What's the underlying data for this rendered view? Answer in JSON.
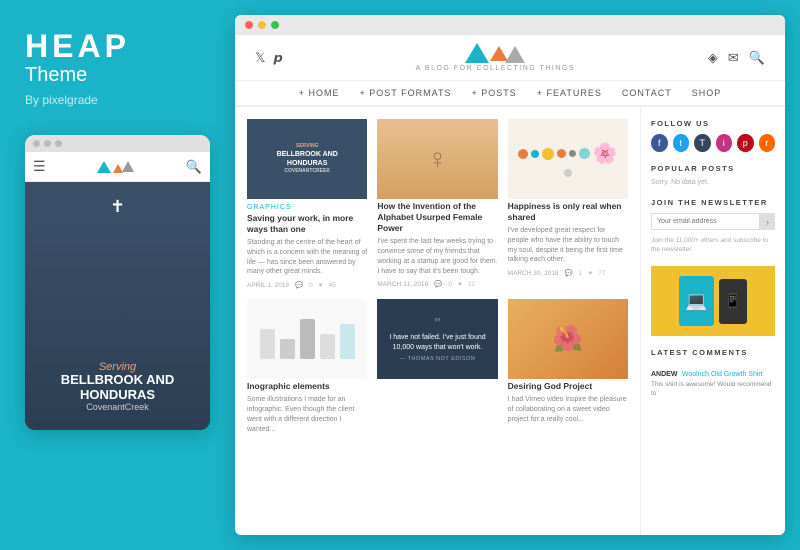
{
  "brand": {
    "name": "HEAP",
    "subtitle": "Theme",
    "by": "By pixelgrade"
  },
  "mobile_preview": {
    "dots": [
      "dot1",
      "dot2",
      "dot3"
    ],
    "post": {
      "italic_line": "Serving",
      "line1": "BELLBROOK AND",
      "line2": "HONDURAS",
      "line3": "CovenantCreek"
    }
  },
  "browser": {
    "dots": [
      "red",
      "yellow",
      "green"
    ]
  },
  "site": {
    "tagline": "A BLOG FOR COLLECTING THINGS",
    "nav_items": [
      "+ HOME",
      "+ POST FORMATS",
      "+ POSTS",
      "+ FEATURES",
      "CONTACT",
      "SHOP"
    ]
  },
  "posts": [
    {
      "category": "GRAPHICS",
      "title": "Saving your work, in more ways than one",
      "excerpt": "Standing at the centre of the heart of which is a concern with the meaning of life — has since been answered by many other great minds.",
      "date": "APRIL 1, 2018",
      "comments": "0",
      "likes": "45"
    },
    {
      "category": "",
      "title": "How the Invention of the Alphabet Usurped Female Power",
      "excerpt": "I've spent the last few weeks trying to convince some of my friends that working at a startup are good for them. I have to say that it's been tough.",
      "date": "MARCH 31, 2018",
      "comments": "0",
      "likes": "22"
    },
    {
      "category": "",
      "title": "Happiness is only real when shared",
      "excerpt": "I've developed great respect for people who have the ability to touch my soul, despite it being the first time talking each other.",
      "date": "MARCH 30, 2018",
      "comments": "1",
      "likes": "77"
    },
    {
      "category": "",
      "title": "Inographic elements",
      "excerpt": "Some illustrations I made for an infographic. Even though the client went with a different direction I wanted...",
      "date": "",
      "comments": "",
      "likes": ""
    },
    {
      "category": "",
      "title": "",
      "excerpt": "",
      "quote": "I have not failed. I've just found 10,000 ways that won't work.",
      "attribution": "— THOMAS NOT EDISON",
      "date": "",
      "comments": "",
      "likes": ""
    },
    {
      "category": "",
      "title": "Desiring God Project",
      "excerpt": "I had Vimeo video inspire the pleasure of collaborating on a sweet video project for a really cool...",
      "date": "",
      "comments": "",
      "likes": ""
    }
  ],
  "sidebar": {
    "follow_us_label": "FOLLOW US",
    "follow_icons": [
      {
        "name": "facebook",
        "char": "f"
      },
      {
        "name": "twitter",
        "char": "t"
      },
      {
        "name": "tumblr",
        "char": "T"
      },
      {
        "name": "instagram",
        "char": "i"
      },
      {
        "name": "pinterest",
        "char": "p"
      },
      {
        "name": "rss",
        "char": "r"
      }
    ],
    "popular_posts_label": "POPULAR POSTS",
    "popular_posts_empty": "Sorry. No data yet.",
    "newsletter_label": "JOIN THE NEWSLETTER",
    "newsletter_placeholder": "Your email address",
    "newsletter_desc": "Join the 11,000+ others and subscribe to the newsletter.",
    "newsletter_btn": "›",
    "latest_comments_label": "LATEST COMMENTS",
    "comments": [
      {
        "author": "ANDEW",
        "product": "Woolrich Old Growth Shirt",
        "text": "This shirt is awesome! Would recommend to"
      }
    ]
  }
}
